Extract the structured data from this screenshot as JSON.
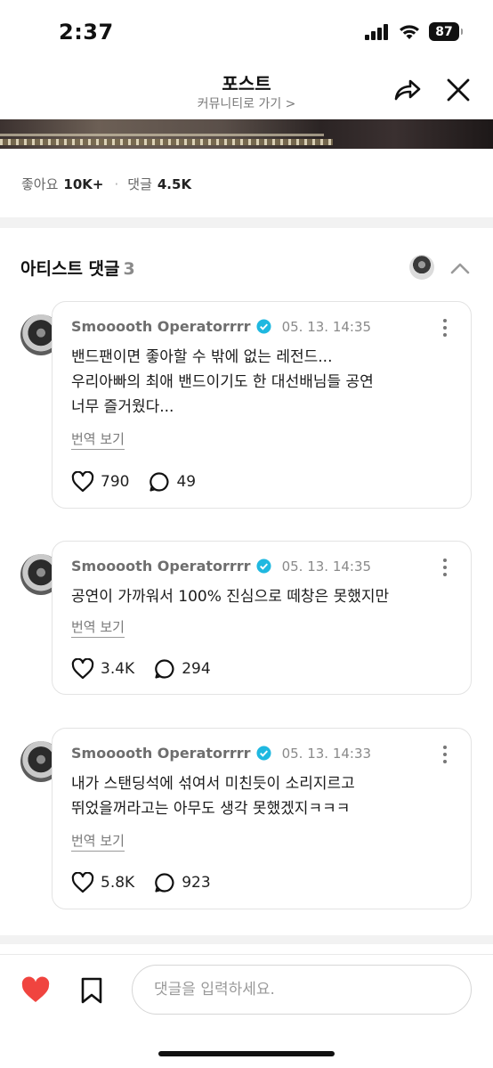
{
  "status_bar": {
    "time": "2:37",
    "battery": "87",
    "icons": [
      "signal-icon",
      "wifi-icon",
      "battery-icon"
    ]
  },
  "header": {
    "title": "포스트",
    "subtitle": "커뮤니티로 가기 >",
    "share_icon": "share-icon",
    "close_icon": "close-icon"
  },
  "stats": {
    "likes_label": "좋아요",
    "likes_value": "10K+",
    "separator": "·",
    "comments_label": "댓글",
    "comments_value": "4.5K"
  },
  "section": {
    "title": "아티스트 댓글",
    "count": "3"
  },
  "comments": [
    {
      "author": "Smooooth Operatorrrr",
      "date": "05. 13. 14:35",
      "lines": [
        "밴드팬이면 좋아할 수 밖에 없는 레전드...",
        "우리아빠의 최애 밴드이기도 한 대선배님들 공연",
        "너무 즐거웠다..."
      ],
      "translate": "번역 보기",
      "likes": "790",
      "replies": "49"
    },
    {
      "author": "Smooooth Operatorrrr",
      "date": "05. 13. 14:35",
      "lines": [
        "공연이 가까워서 100% 진심으로 떼창은 못했지만"
      ],
      "translate": "번역 보기",
      "likes": "3.4K",
      "replies": "294"
    },
    {
      "author": "Smooooth Operatorrrr",
      "date": "05. 13. 14:33",
      "lines": [
        "내가 스탠딩석에 섞여서 미친듯이 소리지르고",
        "뛰었을꺼라고는 아무도 생각 못했겠지ㅋㅋㅋ"
      ],
      "translate": "번역 보기",
      "likes": "5.8K",
      "replies": "923"
    }
  ],
  "bottom": {
    "input_placeholder": "댓글을 입력하세요.",
    "like_color": "#f0443f"
  },
  "colors": {
    "verified": "#1fb8e0",
    "like_active": "#f0443f"
  }
}
